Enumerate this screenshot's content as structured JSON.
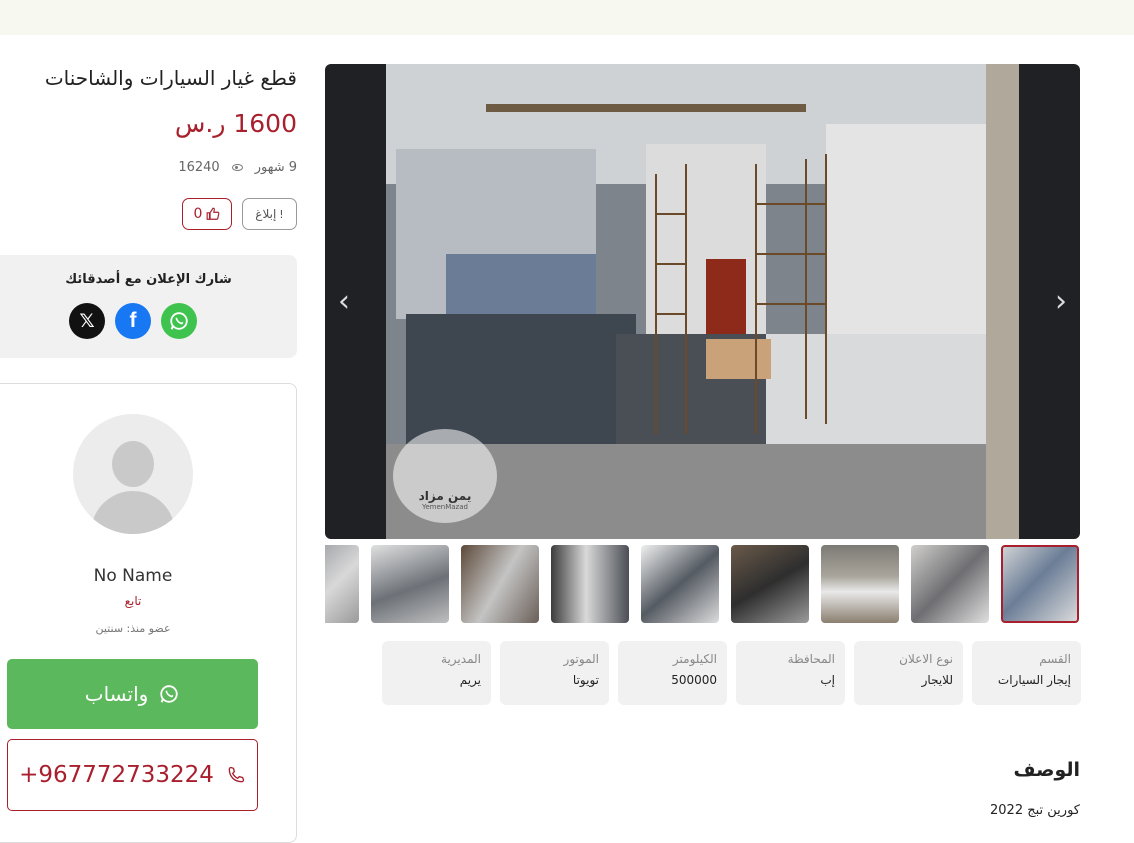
{
  "listing": {
    "title": "قطع غيار السيارات والشاحنات",
    "price": "1600 ر.س",
    "age": "9 شهور",
    "views": "16240",
    "report_label": "إبلاغ",
    "likes": "0"
  },
  "share": {
    "title": "شارك الإعلان مع أصدقائك",
    "icons": [
      "x-icon",
      "facebook-icon",
      "whatsapp-icon"
    ]
  },
  "seller": {
    "name": "No Name",
    "follow_label": "تابع",
    "member_since": "عضو منذ: سنتين",
    "whatsapp_label": "واتساب",
    "phone": "+967772733224"
  },
  "gallery": {
    "watermark_ar": "يمن مزاد",
    "watermark_en": "YemenMazad",
    "thumbnail_count": 9,
    "active_thumbnail": 1
  },
  "specs": [
    {
      "label": "القسم",
      "value": "إيجار السيارات"
    },
    {
      "label": "نوع الاعلان",
      "value": "للايجار"
    },
    {
      "label": "المحافظة",
      "value": "إب"
    },
    {
      "label": "الكيلومتر",
      "value": "500000"
    },
    {
      "label": "الموتور",
      "value": "تويوتا"
    },
    {
      "label": "المديرية",
      "value": "يريم"
    }
  ],
  "description": {
    "title": "الوصف",
    "text": "كورين تبج 2022"
  },
  "colors": {
    "accent": "#a8202d",
    "whatsapp": "#5cb85c",
    "panel": "#f1f1f1"
  }
}
